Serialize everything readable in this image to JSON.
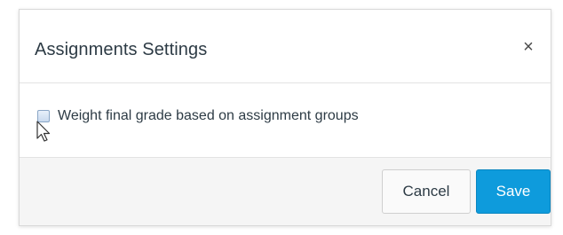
{
  "dialog": {
    "title": "Assignments Settings",
    "close_label": "×"
  },
  "options": {
    "weight_label": "Weight final grade based on assignment groups",
    "weight_checked": false
  },
  "footer": {
    "cancel_label": "Cancel",
    "save_label": "Save"
  },
  "colors": {
    "primary": "#0e9bdc",
    "text": "#2d3b45",
    "footer_bg": "#f5f5f5"
  },
  "icons": {
    "close": "close-icon",
    "cursor": "mouse-pointer-icon"
  }
}
